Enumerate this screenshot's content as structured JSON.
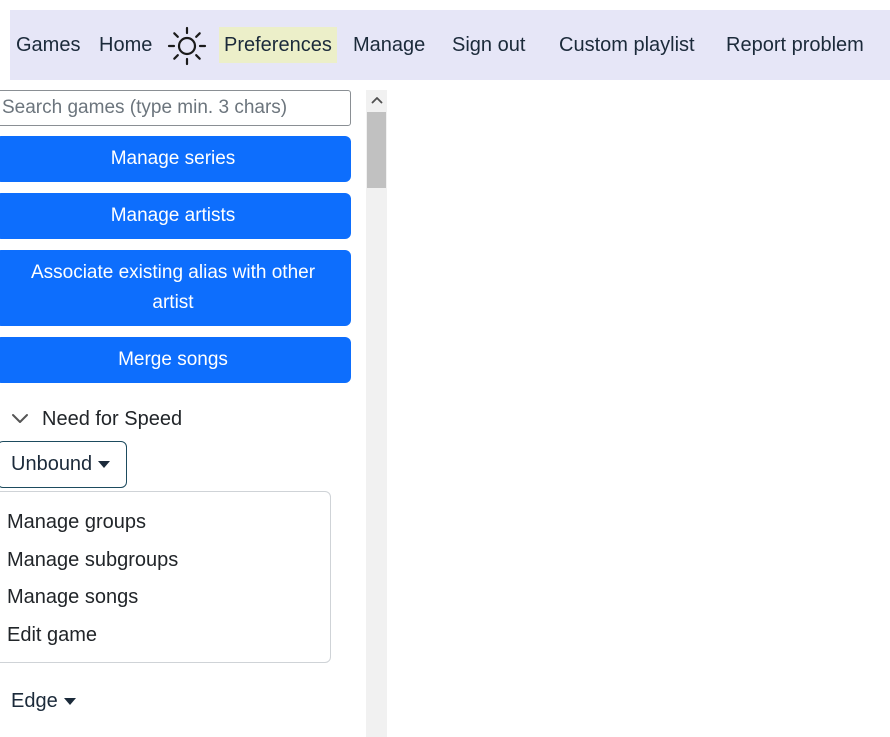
{
  "nav": {
    "items": [
      {
        "label": "Games"
      },
      {
        "label": "Home"
      },
      {
        "label": "Preferences"
      },
      {
        "label": "Manage"
      },
      {
        "label": "Sign out"
      },
      {
        "label": "Custom playlist"
      },
      {
        "label": "Report problem"
      }
    ],
    "theme_icon": "sun-icon",
    "colors": {
      "bar": "#e6e6f7",
      "active": "#ecefc9"
    }
  },
  "search": {
    "placeholder": "Search games (type min. 3 chars)",
    "value": ""
  },
  "actions": {
    "manage_series": "Manage series",
    "manage_artists": "Manage artists",
    "associate_alias": "Associate existing alias with other artist",
    "merge_songs": "Merge songs",
    "color": "#0d6efd"
  },
  "tree": {
    "game_title": "Need for Speed",
    "expand_icon": "chevron-down-icon",
    "subgame_dropdown": "Unbound",
    "hidden_partial": "y",
    "next_dropdown": "Edge"
  },
  "menu": {
    "items": [
      {
        "label": "Manage groups"
      },
      {
        "label": "Manage subgroups"
      },
      {
        "label": "Manage songs"
      },
      {
        "label": "Edit game"
      }
    ]
  }
}
